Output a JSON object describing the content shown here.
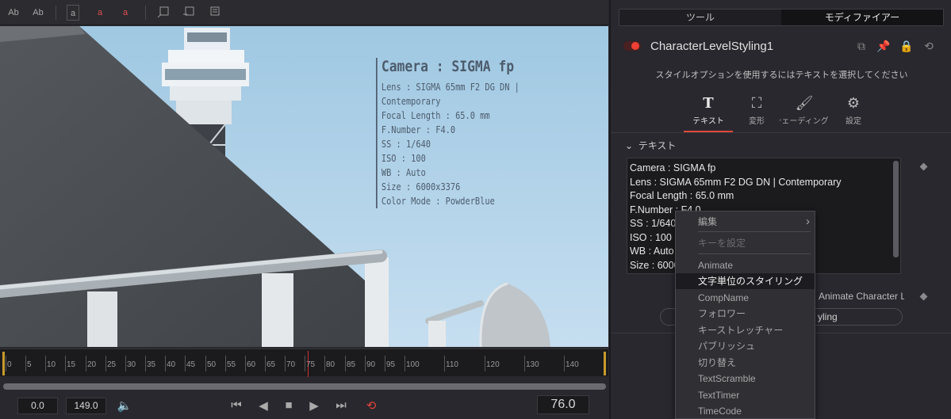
{
  "toolbar": {
    "buttons": [
      {
        "id": "text-ab-1",
        "label": "Ab"
      },
      {
        "id": "text-ab-2",
        "label": "Ab"
      },
      {
        "id": "text-a-1",
        "label": "a"
      },
      {
        "id": "text-a-2",
        "label": "a"
      },
      {
        "id": "text-a-3",
        "label": "a"
      }
    ]
  },
  "overlay": {
    "title": "Camera : SIGMA fp",
    "lines": [
      "Lens : SIGMA 65mm F2 DG DN | Contemporary",
      "Focal Length : 65.0 mm",
      "F.Number : F4.0",
      "SS : 1/640",
      "ISO : 100",
      "WB : Auto",
      "Size : 6000x3376",
      "Color Mode : PowderBlue"
    ]
  },
  "timeline": {
    "ticks": [
      "0",
      "5",
      "10",
      "15",
      "20",
      "25",
      "30",
      "35",
      "40",
      "45",
      "50",
      "55",
      "60",
      "65",
      "70",
      "75",
      "80",
      "85",
      "90",
      "95",
      "100",
      "110",
      "120",
      "130",
      "140"
    ],
    "playhead_frame": 76
  },
  "transport": {
    "start": "0.0",
    "end": "149.0",
    "current": "76.0",
    "colors": {
      "loop": "#e5443a"
    }
  },
  "panel": {
    "tab_tools": "ツール",
    "tab_modifier": "モディファイアー",
    "node_name": "CharacterLevelStyling1",
    "hint": "スタイルオプションを使用するにはテキストを選択してください",
    "inspector_tabs": [
      {
        "icon": "T",
        "label": "テキスト"
      },
      {
        "icon": "transform-icon",
        "label": "変形"
      },
      {
        "icon": "brush-icon",
        "label": "シェーディング"
      },
      {
        "icon": "settings-icon",
        "label": "設定"
      }
    ],
    "section_title": "テキスト",
    "text_lines": [
      "Camera : SIGMA fp",
      "Lens : SIGMA 65mm F2 DG DN | Contemporary",
      "Focal Length : 65.0 mm",
      "F.Number : F4.0",
      "SS : 1/640",
      "ISO : 100",
      "WB : Auto",
      "Size : 6000"
    ],
    "follower_label": "Animate Character Le",
    "follower_button": "yling"
  },
  "menu": {
    "items": [
      {
        "label": "編集",
        "state": "submenu"
      },
      {
        "label": "キーを設定",
        "state": "disabled"
      },
      {
        "label": "Animate",
        "state": "normal"
      },
      {
        "label": "文字単位のスタイリング",
        "state": "highlighted"
      },
      {
        "label": "CompName",
        "state": "normal"
      },
      {
        "label": "フォロワー",
        "state": "normal"
      },
      {
        "label": "キーストレッチャー",
        "state": "normal"
      },
      {
        "label": "パブリッシュ",
        "state": "normal"
      },
      {
        "label": "切り替え",
        "state": "normal"
      },
      {
        "label": "TextScramble",
        "state": "normal"
      },
      {
        "label": "TextTimer",
        "state": "normal"
      },
      {
        "label": "TimeCode",
        "state": "normal"
      }
    ]
  },
  "colors": {
    "accent": "#e0483c",
    "sky": "#a9cde3",
    "panel": "#28282e"
  }
}
